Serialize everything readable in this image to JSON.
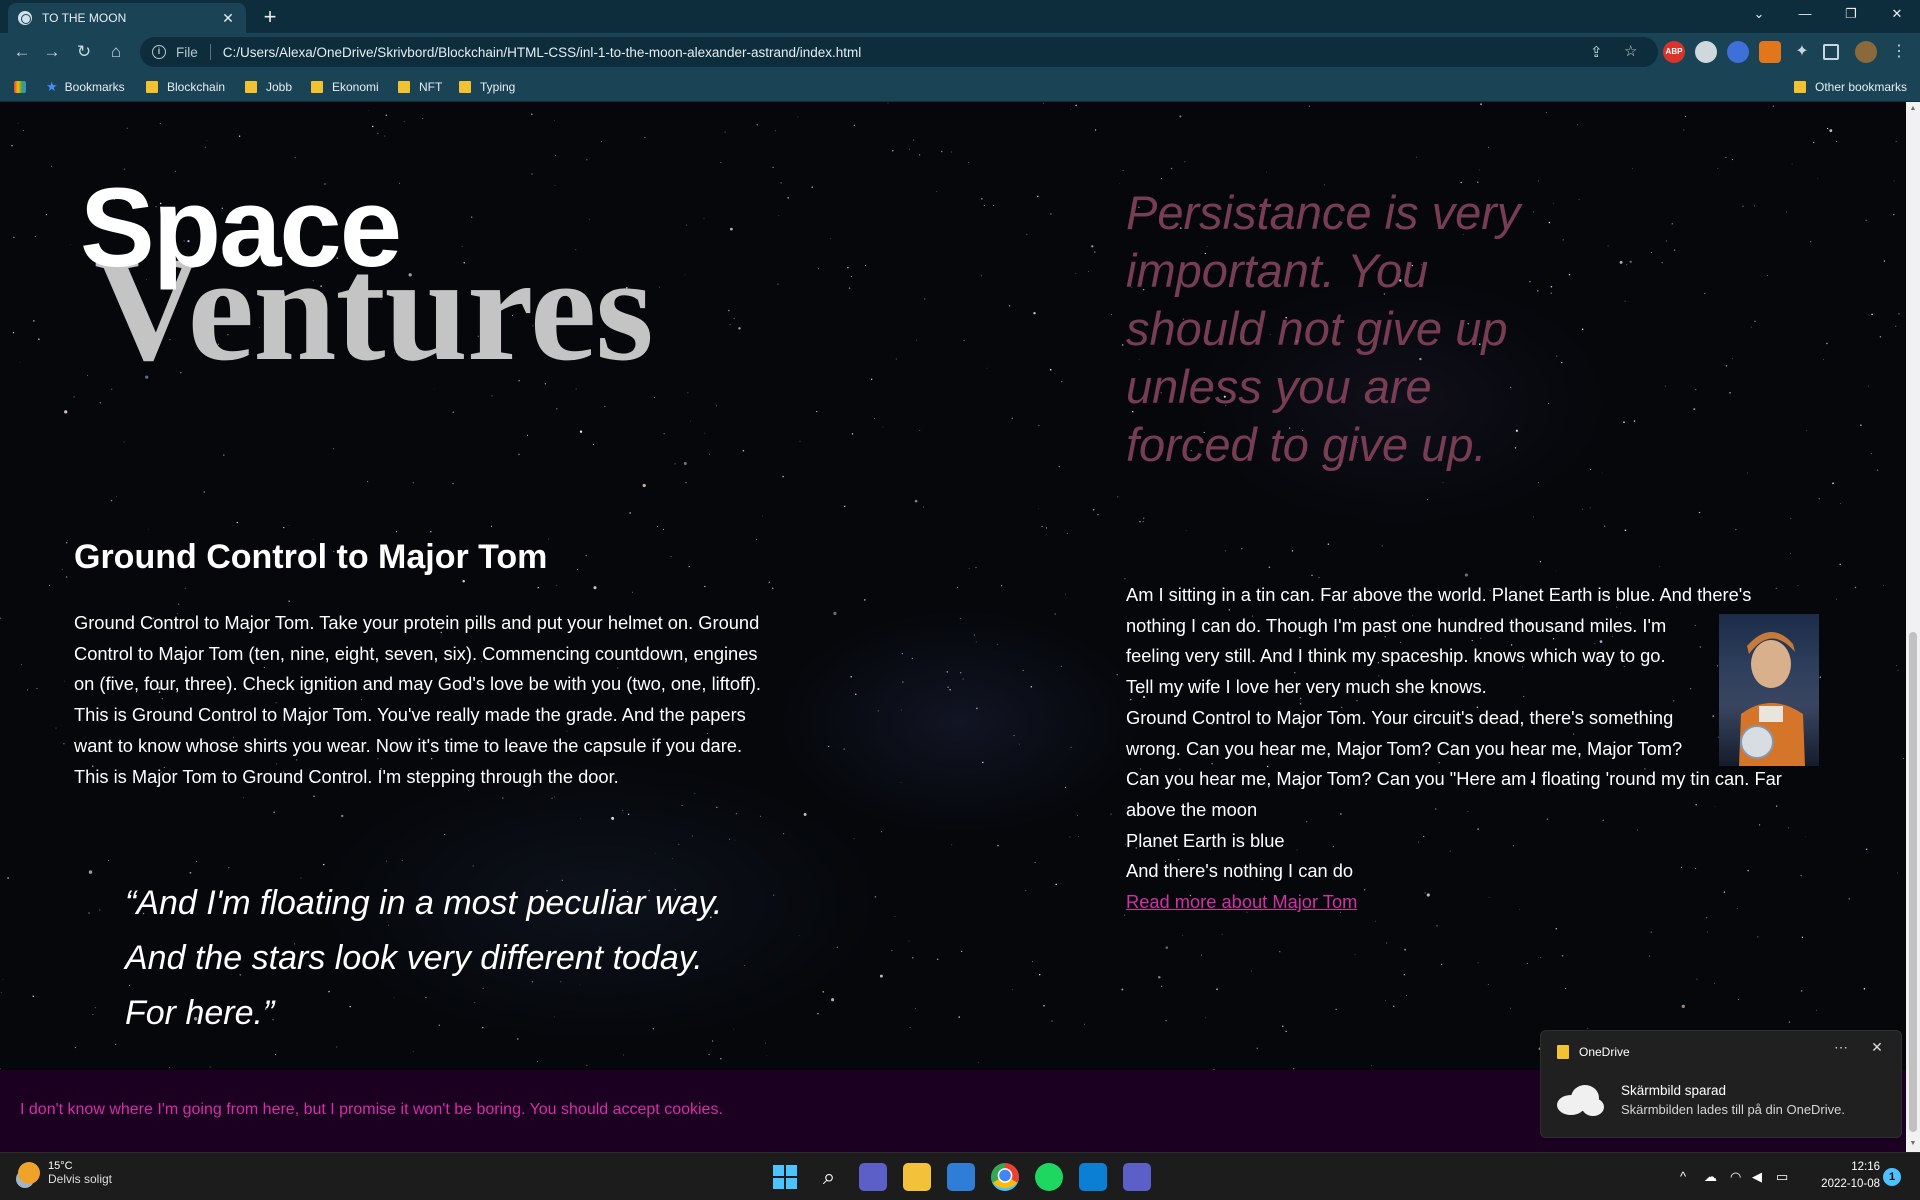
{
  "browser": {
    "tab_title": "TO THE MOON",
    "url_scheme": "File",
    "url": "C:/Users/Alexa/OneDrive/Skrivbord/Blockchain/HTML-CSS/inl-1-to-the-moon-alexander-astrand/index.html",
    "bookmarks": [
      "Bookmarks",
      "Blockchain",
      "Jobb",
      "Ekonomi",
      "NFT",
      "Typing"
    ],
    "other_bookmarks": "Other bookmarks",
    "extensions": [
      "ABP"
    ]
  },
  "page": {
    "logo_top": "Space",
    "logo_bottom": "Ventures",
    "persistance_quote": "Persistance is very important. You should not give up unless you are forced to give up.",
    "heading": "Ground Control to Major Tom",
    "left_paragraph": "Ground Control to Major Tom. Take your protein pills and put your helmet on. Ground Control to Major Tom (ten, nine, eight, seven, six). Commencing countdown, engines on (five, four, three). Check ignition and may God's love be with you (two, one, liftoff). This is Ground Control to Major Tom. You've really made the grade. And the papers want to know whose shirts you wear. Now it's time to leave the capsule if you dare. This is Major Tom to Ground Control. I'm stepping through the door.",
    "quote_lines": [
      "“And I'm floating in a most peculiar way.",
      "And the stars look very different today.",
      "For here.”"
    ],
    "right_lines": [
      "Am I sitting in a tin can. Far above the world. Planet Earth is blue. And there's",
      "nothing I can do. Though I'm past one hundred thousand miles. I'm",
      "feeling very still. And I think my spaceship. knows which way to go.",
      "Tell my wife I love her very much she knows.",
      "Ground Control to Major Tom. Your circuit's dead, there's something",
      "wrong. Can you hear me, Major Tom? Can you hear me, Major Tom?",
      "Can you hear me, Major Tom? Can you \"Here am I floating 'round my tin can. Far",
      "above the moon",
      "Planet Earth is blue",
      "And there's nothing I can do"
    ],
    "read_more_link": "Read more about Major Tom",
    "cookie_banner": "I don't know where I'm going from here, but I promise it won't be boring. You should accept cookies."
  },
  "toast": {
    "app": "OneDrive",
    "title": "Skärmbild sparad",
    "body": "Skärmbilden lades till på din OneDrive.",
    "more": "⋯",
    "close": "✕"
  },
  "taskbar": {
    "weather_temp": "15°C",
    "weather_desc": "Delvis soligt",
    "time": "12:16",
    "date": "2022-10-08",
    "notification_count": "1"
  },
  "colors": {
    "accent_pink": "#d230a7",
    "chrome_bg": "#1a4356",
    "quote_muted": "#8c465f"
  }
}
